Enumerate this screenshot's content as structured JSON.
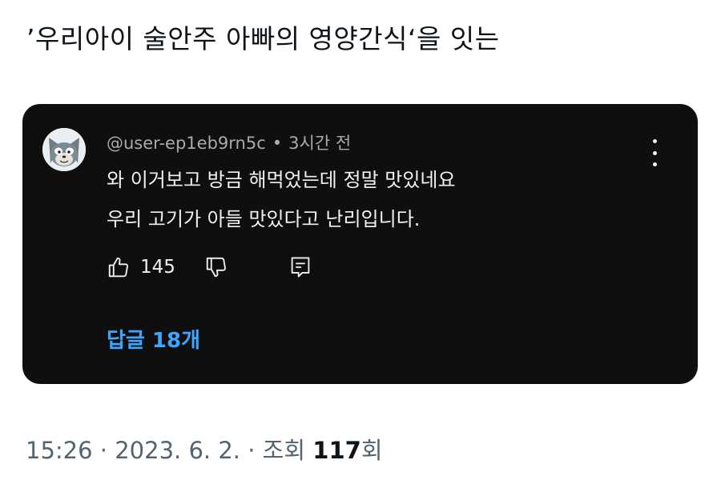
{
  "post": {
    "text": "’우리아이 술안주 아빠의 영양간식‘을 잇는"
  },
  "comment_card": {
    "username": "@user-ep1eb9rn5c",
    "separator": "•",
    "time_ago": "3시간 전",
    "lines": [
      "와 이거보고 방금 해먹었는데 정말 맛있네요",
      "우리 고기가 아들 맛있다고 난리입니다."
    ],
    "like_count": "145",
    "replies_label": "답글 18개",
    "icons": {
      "avatar": "cat-avatar",
      "menu": "more-vertical-icon",
      "like": "thumbs-up-icon",
      "dislike": "thumbs-down-icon",
      "reply": "reply-comment-icon"
    },
    "colors": {
      "card_bg": "#0f0f0f",
      "link": "#3ea6ff",
      "text": "#f1f1f1",
      "meta": "#aaaaaa"
    }
  },
  "footer": {
    "time_date": "15:26 · 2023. 6. 2. · 조회 ",
    "views": "117",
    "views_suffix": "회"
  }
}
